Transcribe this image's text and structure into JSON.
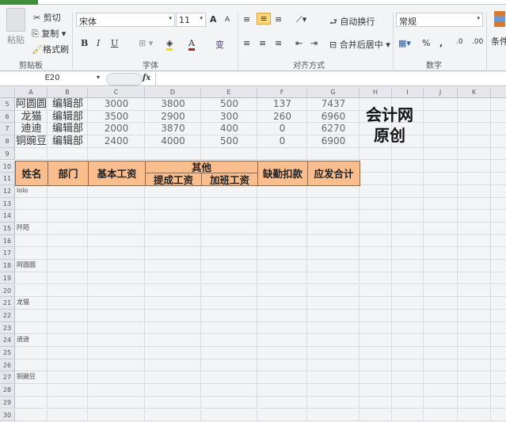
{
  "ribbon": {
    "clipboard": {
      "paste": "粘贴",
      "cut": "剪切",
      "copy": "复制",
      "format_painter": "格式刷",
      "label": "剪贴板"
    },
    "font": {
      "name": "宋体",
      "size": "11",
      "bold": "B",
      "italic": "I",
      "underline": "U",
      "font_color": "A",
      "grow": "A",
      "shrink": "A",
      "phonetic": "变",
      "label": "字体"
    },
    "alignment": {
      "wrap": "自动换行",
      "merge": "合并后居中",
      "label": "对齐方式"
    },
    "number": {
      "format": "常规",
      "percent": "%",
      "comma": ",",
      "label": "数字"
    },
    "styles": {
      "conditional": "条件"
    }
  },
  "formula_bar": {
    "name_box": "E20",
    "fx": "fx",
    "value": ""
  },
  "columns": [
    "A",
    "B",
    "C",
    "D",
    "E",
    "F",
    "G",
    "H",
    "I",
    "J",
    "K"
  ],
  "rows": [
    "5",
    "6",
    "7",
    "8",
    "9",
    "10",
    "11",
    "12",
    "13",
    "14",
    "15",
    "16",
    "17",
    "18",
    "19",
    "20",
    "21",
    "22",
    "23",
    "24",
    "25",
    "26",
    "27",
    "28",
    "29",
    "30"
  ],
  "data_rows": [
    [
      "阿圆圆",
      "编辑部",
      "3000",
      "3800",
      "500",
      "137",
      "7437"
    ],
    [
      "龙猫",
      "编辑部",
      "3500",
      "2900",
      "300",
      "260",
      "6960"
    ],
    [
      "迪迪",
      "编辑部",
      "2000",
      "3870",
      "400",
      "0",
      "6270"
    ],
    [
      "铜豌豆",
      "编辑部",
      "2400",
      "4000",
      "500",
      "0",
      "6900"
    ]
  ],
  "header": {
    "name": "姓名",
    "dept": "部门",
    "base": "基本工资",
    "other": "其他",
    "commission": "提成工资",
    "overtime": "加班工资",
    "absence": "缺勤扣款",
    "total": "应发合计"
  },
  "watermark": [
    "会计网",
    "原创"
  ],
  "col_a_labels": [
    {
      "row": "12",
      "text": "lolo"
    },
    {
      "row": "15",
      "text": "阡陌"
    },
    {
      "row": "18",
      "text": "阿圆圆"
    },
    {
      "row": "21",
      "text": "龙猫"
    },
    {
      "row": "24",
      "text": "迪迪"
    },
    {
      "row": "27",
      "text": "铜豌豆"
    }
  ],
  "colors": {
    "header_fill": "#f9bd8e",
    "accent": "#3e8e3a"
  }
}
